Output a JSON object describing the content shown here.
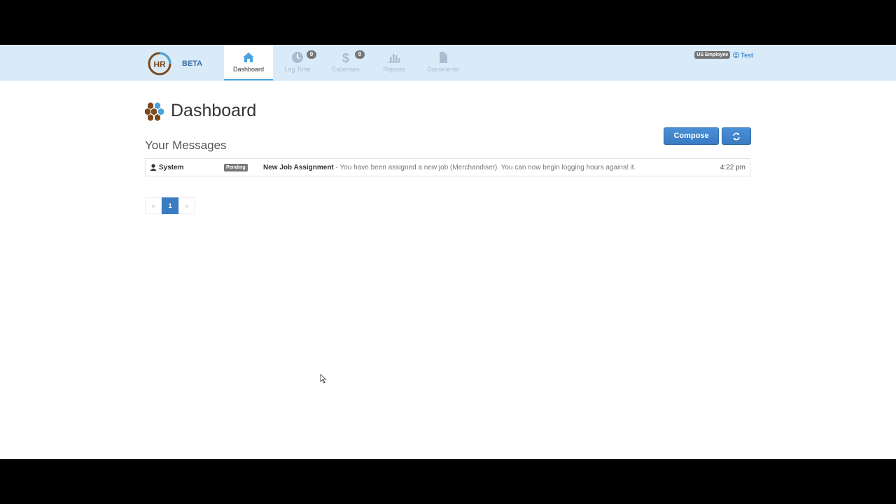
{
  "brand": {
    "logo_text": "HR",
    "tag": "BETA"
  },
  "nav": [
    {
      "label": "Dashboard",
      "icon": "home-icon",
      "active": true
    },
    {
      "label": "Log Time",
      "icon": "clock-icon",
      "badge": "0"
    },
    {
      "label": "Expenses",
      "icon": "dollar-icon",
      "badge": "0"
    },
    {
      "label": "Reports",
      "icon": "bar-chart-icon"
    },
    {
      "label": "Documents",
      "icon": "document-icon"
    }
  ],
  "user": {
    "role": "US Employee",
    "name": "Test"
  },
  "page": {
    "title": "Dashboard",
    "subtitle": "Your Messages"
  },
  "actions": {
    "compose": "Compose",
    "refresh_icon": "refresh-icon"
  },
  "messages": [
    {
      "from": "System",
      "status": "Pending",
      "subject": "New Job Assignment",
      "body": " - You have been assigned a new job (Merchandiser). You can now begin logging hours against it.",
      "time": "4:22 pm"
    }
  ],
  "pagination": {
    "prev": "«",
    "current": "1",
    "next": "»"
  },
  "colors": {
    "navbar": "#d9ebf9",
    "accent": "#3a7bc2",
    "brand_brown": "#7b4a1e"
  }
}
